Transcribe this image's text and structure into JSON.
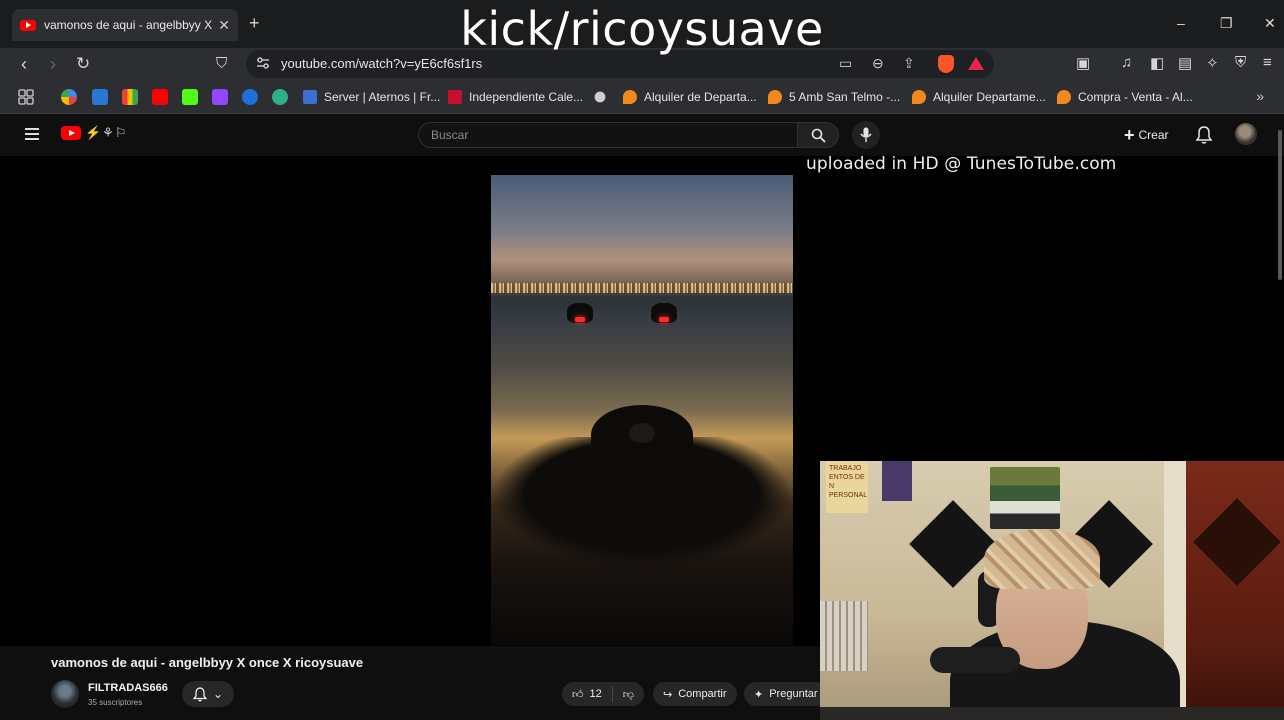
{
  "browser": {
    "tab_title": "vamonos de aqui - angelbbyy X ",
    "tab_close": "✕",
    "new_tab": "+",
    "url": "youtube.com/watch?v=yE6cf6sf1rs",
    "window_controls": {
      "minimize": "–",
      "restore": "❐",
      "close": "✕"
    },
    "bookmarks": [
      {
        "label": "Server | Aternos | Fr...",
        "color": "#3b6fd1"
      },
      {
        "label": "Independiente Cale...",
        "color": "#c8102e"
      },
      {
        "label": "Alquiler de Departa...",
        "color": "#f28a1a"
      },
      {
        "label": "5 Amb San Telmo -...",
        "color": "#f28a1a"
      },
      {
        "label": "Alquiler Departame...",
        "color": "#f28a1a"
      },
      {
        "label": "Compra - Venta - Al...",
        "color": "#f28a1a"
      }
    ],
    "bookmarks_more": "»"
  },
  "overlay": {
    "stream_title": "kick/ricoysuave",
    "uploaded_text": "uploaded in HD @ TunesToTube.com"
  },
  "youtube": {
    "search_placeholder": "Buscar",
    "create_label": "Crear",
    "create_plus": "+",
    "video_title": "vamonos de aqui - angelbbyy X once X ricoysuave",
    "channel_name": "FILTRADAS666",
    "channel_subs": "35 suscriptores",
    "subscribe_chevron": "⌄",
    "likes": "12",
    "share_label": "Compartir",
    "ask_label": "Preguntar"
  },
  "webcam": {
    "sign_text": "TRABAJO\nENTOS DE\nN PERSONAL"
  },
  "colors": {
    "youtube_red": "#ff0000",
    "brave_orange": "#fb542b",
    "brave_rewards": "#e5254b"
  }
}
